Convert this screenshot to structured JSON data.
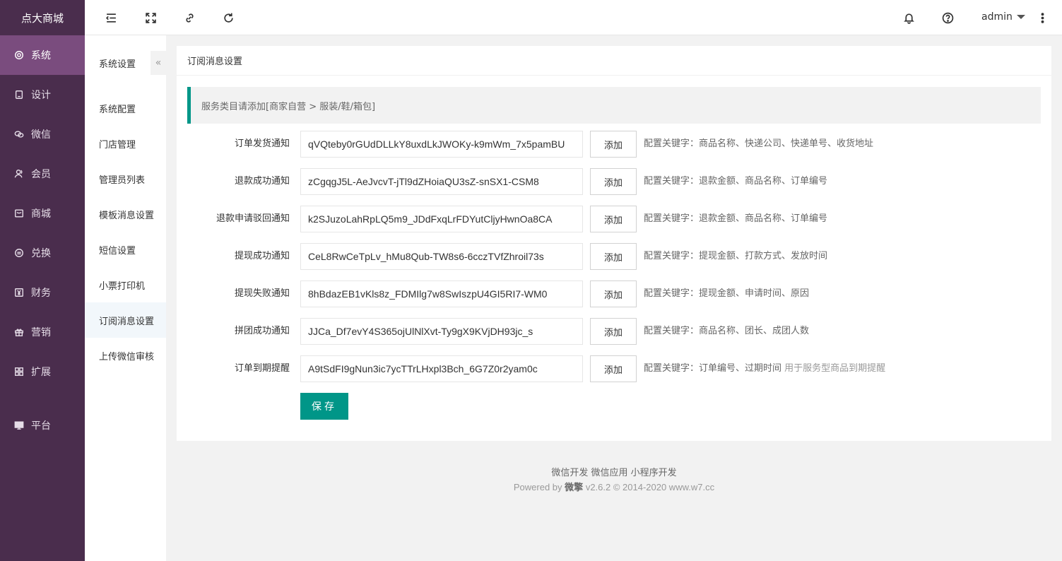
{
  "brand": "点大商城",
  "nav": [
    {
      "label": "系统",
      "icon": "gear-icon"
    },
    {
      "label": "设计",
      "icon": "tablet-icon"
    },
    {
      "label": "微信",
      "icon": "wechat-icon"
    },
    {
      "label": "会员",
      "icon": "user-icon"
    },
    {
      "label": "商城",
      "icon": "shop-icon"
    },
    {
      "label": "兑换",
      "icon": "exchange-icon"
    },
    {
      "label": "财务",
      "icon": "yen-icon"
    },
    {
      "label": "营销",
      "icon": "gift-icon"
    },
    {
      "label": "扩展",
      "icon": "grid-icon"
    },
    {
      "label": "平台",
      "icon": "monitor-icon"
    }
  ],
  "header": {
    "user": "admin"
  },
  "subnav": {
    "title": "系统设置",
    "items": [
      "系统配置",
      "门店管理",
      "管理员列表",
      "模板消息设置",
      "短信设置",
      "小票打印机",
      "订阅消息设置",
      "上传微信审核"
    ]
  },
  "card": {
    "title": "订阅消息设置",
    "notice": "服务类目请添加[商家自营 > 服装/鞋/箱包]",
    "add_label": "添加",
    "save_label": "保存",
    "rows": [
      {
        "label": "订单发货通知",
        "value": "qVQteby0rGUdDLLkY8uxdLkJWOKy-k9mWm_7x5pamBU",
        "hint": "配置关键字：商品名称、快递公司、快递单号、收货地址",
        "extra": ""
      },
      {
        "label": "退款成功通知",
        "value": "zCgqgJ5L-AeJvcvT-jTl9dZHoiaQU3sZ-snSX1-CSM8",
        "hint": "配置关键字：退款金额、商品名称、订单编号",
        "extra": ""
      },
      {
        "label": "退款申请驳回通知",
        "value": "k2SJuzoLahRpLQ5m9_JDdFxqLrFDYutCljyHwnOa8CA",
        "hint": "配置关键字：退款金额、商品名称、订单编号",
        "extra": ""
      },
      {
        "label": "提现成功通知",
        "value": "CeL8RwCeTpLv_hMu8Qub-TW8s6-6cczTVfZhroil73s",
        "hint": "配置关键字：提现金额、打款方式、发放时间",
        "extra": ""
      },
      {
        "label": "提现失败通知",
        "value": "8hBdazEB1vKls8z_FDMIlg7w8SwIszpU4GI5RI7-WM0",
        "hint": "配置关键字：提现金额、申请时间、原因",
        "extra": ""
      },
      {
        "label": "拼团成功通知",
        "value": "JJCa_Df7evY4S365ojUlNlXvt-Ty9gX9KVjDH93jc_s",
        "hint": "配置关键字：商品名称、团长、成团人数",
        "extra": ""
      },
      {
        "label": "订单到期提醒",
        "value": "A9tSdFI9gNun3ic7ycTTrLHxpl3Bch_6G7Z0r2yam0c",
        "hint": "配置关键字：订单编号、过期时间",
        "extra": "用于服务型商品到期提醒"
      }
    ]
  },
  "footer": {
    "links": "微信开发 微信应用 小程序开发",
    "powered_prefix": "Powered by",
    "powered_brand": "微擎",
    "powered_suffix": "v2.6.2 © 2014-2020 www.w7.cc"
  }
}
